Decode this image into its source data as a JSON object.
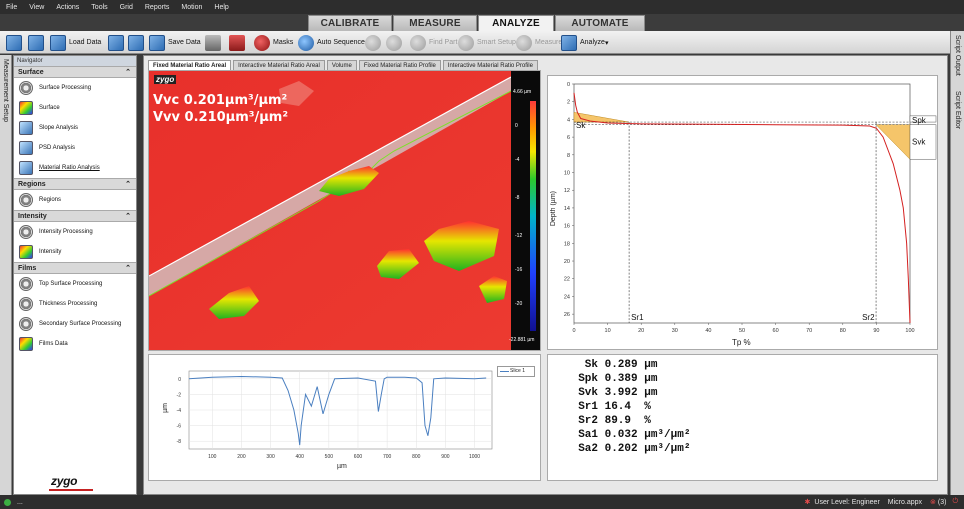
{
  "menu": [
    "File",
    "View",
    "Actions",
    "Tools",
    "Grid",
    "Reports",
    "Motion",
    "Help"
  ],
  "main_tabs": [
    {
      "label": "CALIBRATE",
      "active": false
    },
    {
      "label": "MEASURE",
      "active": false
    },
    {
      "label": "ANALYZE",
      "active": true
    },
    {
      "label": "AUTOMATE",
      "active": false
    }
  ],
  "toolbar": {
    "load_data": "Load Data",
    "save_data": "Save Data",
    "masks": "Masks",
    "auto_sequence": "Auto Sequence",
    "find_part": "Find Part",
    "smart_setup": "Smart Setup",
    "measure": "Measure",
    "analyze": "Analyze"
  },
  "side_left_label": "Measurement Setup",
  "side_right_labels": [
    "Script Output",
    "Script Editor"
  ],
  "navigator": {
    "title": "Navigator",
    "sections": [
      {
        "name": "Surface",
        "items": [
          "Surface Processing",
          "Surface",
          "Slope Analysis",
          "PSD Analysis",
          "Material Ratio Analysis"
        ]
      },
      {
        "name": "Regions",
        "items": [
          "Regions"
        ]
      },
      {
        "name": "Intensity",
        "items": [
          "Intensity Processing",
          "Intensity"
        ]
      },
      {
        "name": "Films",
        "items": [
          "Top Surface Processing",
          "Thickness Processing",
          "Secondary Surface Processing",
          "Films Data"
        ]
      }
    ],
    "logo": "zygo"
  },
  "subtabs": [
    "Fixed Material Ratio Areal",
    "Interactive Material Ratio Areal",
    "Volume",
    "Fixed Material Ratio Profile",
    "Interactive Material Ratio Profile"
  ],
  "surface_view": {
    "logo": "zygo",
    "vvc": "Vvc 0.201µm³/µm²",
    "vvv": "Vvv 0.210µm³/µm²",
    "colorbar_top": "4.66 µm",
    "colorbar_bottom": "-22.881 µm",
    "colorbar_ticks": [
      "0",
      "-4",
      "-8",
      "-12",
      "-16",
      "-20"
    ]
  },
  "profile_chart": {
    "ylabel": "µm",
    "xlabel": "µm",
    "legend": "Slice 1",
    "x_ticks": [
      "100",
      "200",
      "300",
      "400",
      "500",
      "600",
      "700",
      "800",
      "900",
      "1000"
    ],
    "y_ticks": [
      "0",
      "-2",
      "-4",
      "-6",
      "-8"
    ]
  },
  "bearing_chart": {
    "ylabel": "Depth (µm)",
    "xlabel": "Tp %",
    "x_ticks": [
      "0",
      "10",
      "20",
      "30",
      "40",
      "50",
      "60",
      "70",
      "80",
      "90",
      "100"
    ],
    "y_ticks": [
      "0",
      "2",
      "4",
      "6",
      "8",
      "10",
      "12",
      "14",
      "16",
      "18",
      "20",
      "22",
      "24",
      "26"
    ],
    "labels": {
      "sk": "Sk",
      "spk": "Spk",
      "svk": "Svk",
      "sr1": "Sr1",
      "sr2": "Sr2"
    }
  },
  "chart_data": [
    {
      "type": "line",
      "title": "",
      "xlabel": "µm",
      "ylabel": "µm",
      "xlim": [
        20,
        1060
      ],
      "ylim": [
        -9,
        1
      ],
      "series": [
        {
          "name": "Slice 1",
          "x": [
            20,
            100,
            200,
            300,
            340,
            360,
            380,
            395,
            400,
            405,
            420,
            440,
            460,
            480,
            500,
            520,
            600,
            660,
            670,
            680,
            690,
            700,
            760,
            800,
            820,
            830,
            840,
            850,
            860,
            900,
            1000,
            1040
          ],
          "y": [
            0,
            0.2,
            0.3,
            0.2,
            0.1,
            -1.5,
            -4,
            -7,
            -8.5,
            -6,
            -2,
            -3.5,
            -1,
            -4.5,
            -2,
            0,
            0.1,
            -0.3,
            -4.2,
            -2,
            0,
            0.2,
            0.2,
            0.1,
            -0.5,
            -6,
            -7.3,
            -5,
            0,
            0.1,
            0,
            0.1
          ]
        }
      ]
    },
    {
      "type": "line",
      "title": "",
      "xlabel": "Tp %",
      "ylabel": "Depth (µm)",
      "xlim": [
        0,
        100
      ],
      "ylim": [
        27,
        0
      ],
      "series": [
        {
          "name": "",
          "x": [
            0,
            0.5,
            1,
            2,
            5,
            10,
            20,
            40,
            60,
            80,
            88,
            90,
            92,
            95,
            97,
            98,
            99,
            99.5,
            100
          ],
          "y": [
            1,
            2.4,
            3.2,
            3.9,
            4.2,
            4.4,
            4.5,
            4.55,
            4.6,
            4.65,
            4.75,
            5,
            6,
            9,
            12,
            14,
            18,
            22,
            27
          ]
        }
      ]
    }
  ],
  "results": [
    {
      "label": "Sk",
      "value": "0.289 µm"
    },
    {
      "label": "Spk",
      "value": "0.389 µm"
    },
    {
      "label": "Svk",
      "value": "3.992 µm"
    },
    {
      "label": "Sr1",
      "value": "16.4  %"
    },
    {
      "label": "Sr2",
      "value": "89.9  %"
    },
    {
      "label": "Sa1",
      "value": "0.032 µm³/µm²"
    },
    {
      "label": "Sa2",
      "value": "0.202 µm³/µm²"
    }
  ],
  "status": {
    "left": "...",
    "user_level": "User Level: Engineer",
    "app_file": "Micro.appx",
    "count": "(3)"
  }
}
